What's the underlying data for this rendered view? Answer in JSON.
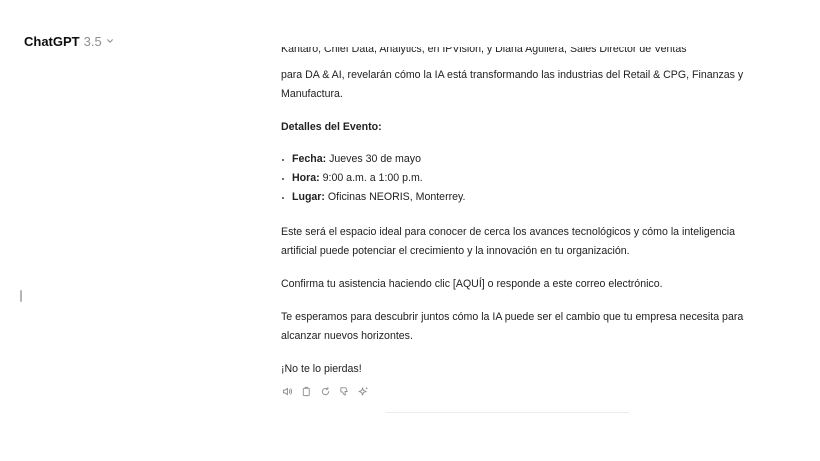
{
  "header": {
    "model_name": "ChatGPT",
    "model_version": "3.5"
  },
  "message": {
    "cut_line": "Kantaro, Chief Data, Analytics, en IPVision, y Diana Aguilera, Sales Director de Ventas",
    "paragraph1": "para DA & AI, revelarán cómo la IA está transformando las industrias del Retail & CPG, Finanzas y Manufactura.",
    "details_heading": "Detalles del Evento:",
    "details": [
      {
        "key": "Fecha:",
        "value": " Jueves 30 de mayo"
      },
      {
        "key": "Hora:",
        "value": " 9:00 a.m. a 1:00 p.m."
      },
      {
        "key": "Lugar:",
        "value": " Oficinas NEORIS, Monterrey."
      }
    ],
    "paragraph2": "Este será el espacio ideal para conocer de cerca los avances tecnológicos y cómo la inteligencia artificial puede potenciar el crecimiento y la innovación en tu organización.",
    "paragraph3": "Confirma tu asistencia haciendo clic [AQUÍ] o responde a este correo electrónico.",
    "paragraph4": "Te esperamos para descubrir juntos cómo la IA puede ser el cambio que tu empresa necesita para alcanzar nuevos horizontes.",
    "paragraph5": "¡No te lo pierdas!"
  },
  "actions": [
    {
      "icon": "speaker-icon"
    },
    {
      "icon": "copy-icon"
    },
    {
      "icon": "regenerate-icon"
    },
    {
      "icon": "thumbs-down-icon"
    },
    {
      "icon": "sparkle-icon"
    }
  ],
  "colors": {
    "text": "#222222",
    "muted": "#8e8e8e",
    "icon": "#8e8e8e"
  }
}
